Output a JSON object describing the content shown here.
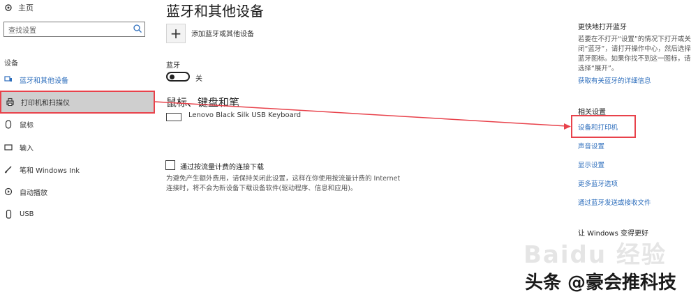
{
  "sidebar": {
    "home_label": "主页",
    "search_placeholder": "查找设置",
    "group_label": "设备",
    "items": [
      {
        "label": "蓝牙和其他设备",
        "icon": "bluetooth-icon"
      },
      {
        "label": "打印机和扫描仪",
        "icon": "printer-icon"
      },
      {
        "label": "鼠标",
        "icon": "mouse-icon"
      },
      {
        "label": "输入",
        "icon": "keyboard-icon"
      },
      {
        "label": "笔和 Windows Ink",
        "icon": "pen-icon"
      },
      {
        "label": "自动播放",
        "icon": "autoplay-icon"
      },
      {
        "label": "USB",
        "icon": "usb-icon"
      }
    ]
  },
  "main": {
    "title": "蓝牙和其他设备",
    "add_device_label": "添加蓝牙或其他设备",
    "bluetooth_label": "蓝牙",
    "bluetooth_state": "关",
    "mouse_section_heading": "鼠标、键盘和笔",
    "keyboard_device": "Lenovo Black Silk USB Keyboard",
    "metered_checkbox_label": "通过按流量计费的连接下载",
    "metered_description": "为避免产生额外费用，请保持关闭此设置，这样在你使用按流量计费的 Internet 连接时，将不会为新设备下载设备软件(驱动程序、信息和应用)。"
  },
  "right": {
    "quick_heading": "更快地打开蓝牙",
    "quick_text": "若要在不打开“设置”的情况下打开或关闭“蓝牙”，请打开操作中心，然后选择蓝牙图标。如果你找不到这一图标，请选择“展开”。",
    "quick_link": "获取有关蓝牙的详细信息",
    "related_heading": "相关设置",
    "related_links": [
      "设备和打印机",
      "声音设置",
      "显示设置",
      "更多蓝牙选项",
      "通过蓝牙发送或接收文件"
    ],
    "windows_heading": "让 Windows 变得更好"
  },
  "watermark": {
    "logo_text": "Baidu 经验",
    "caption": "头条 @豪会推科技"
  },
  "colors": {
    "accent": "#2f6fbd",
    "highlight": "#e8424b",
    "selected_bg": "#cfcfcf"
  }
}
